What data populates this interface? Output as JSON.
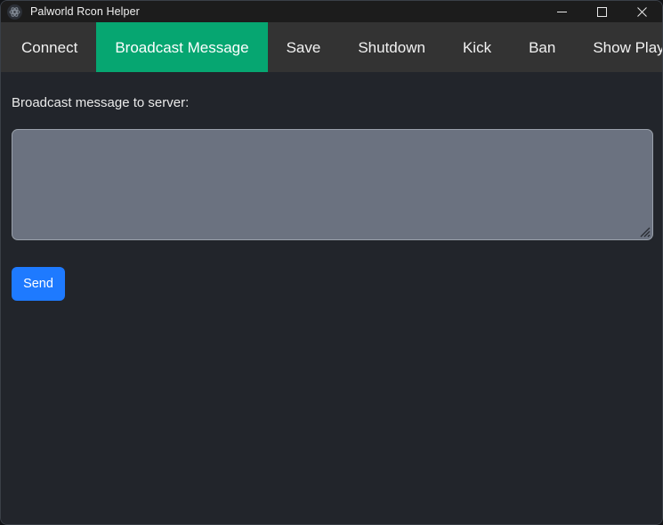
{
  "window": {
    "title": "Palworld Rcon Helper",
    "app_icon": "settings-gear-icon",
    "minimize_label": "Minimize",
    "maximize_label": "Maximize",
    "close_label": "Close"
  },
  "tabs": {
    "active_index": 1,
    "items": [
      {
        "label": "Connect"
      },
      {
        "label": "Broadcast Message"
      },
      {
        "label": "Save"
      },
      {
        "label": "Shutdown"
      },
      {
        "label": "Kick"
      },
      {
        "label": "Ban"
      },
      {
        "label": "Show Players"
      }
    ]
  },
  "main": {
    "field_label": "Broadcast message to server:",
    "message_value": "",
    "message_placeholder": "",
    "send_label": "Send"
  },
  "colors": {
    "titlebar_bg": "#1c1c1c",
    "tabstrip_bg": "#333333",
    "tab_active_bg": "#06a671",
    "content_bg": "#22252b",
    "textarea_bg": "#6b7280",
    "send_button_bg": "#1e7aff",
    "text": "#f2f2f2"
  }
}
